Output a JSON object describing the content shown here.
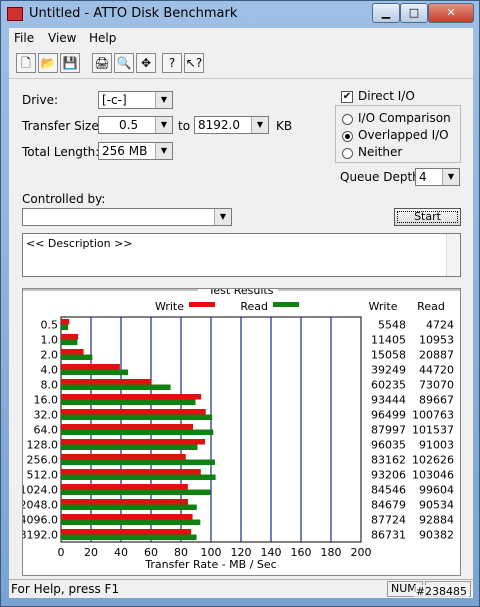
{
  "window": {
    "title": "Untitled - ATTO Disk Benchmark",
    "min_glyph": "▁",
    "max_glyph": "□",
    "close_glyph": "✕"
  },
  "menu": [
    "File",
    "View",
    "Help"
  ],
  "toolbar": [
    {
      "name": "new-icon",
      "glyph": "🗋"
    },
    {
      "name": "open-icon",
      "glyph": "📂"
    },
    {
      "name": "save-icon",
      "glyph": "💾"
    },
    {
      "name": "print-icon",
      "glyph": "🖨"
    },
    {
      "name": "print-preview-icon",
      "glyph": "🔍"
    },
    {
      "name": "move-icon",
      "glyph": "✥"
    },
    {
      "name": "help-icon",
      "glyph": "?"
    },
    {
      "name": "context-help-icon",
      "glyph": "↖?"
    }
  ],
  "form": {
    "drive_label": "Drive:",
    "drive_value": "[-c-]",
    "transfer_size_label": "Transfer Size:",
    "transfer_from": "0.5",
    "to_label": "to",
    "transfer_to": "8192.0",
    "kb_label": "KB",
    "total_length_label": "Total Length:",
    "total_length_value": "256 MB",
    "controlled_by_label": "Controlled by:",
    "controlled_by_value": "",
    "direct_io_label": "Direct I/O",
    "direct_io_checked": true,
    "io_comparison_label": "I/O Comparison",
    "overlapped_io_label": "Overlapped I/O",
    "neither_label": "Neither",
    "selected_mode": "Overlapped I/O",
    "queue_depth_label": "Queue Depth:",
    "queue_depth_value": "4",
    "start_label": "Start",
    "description_value": "<< Description >>"
  },
  "results": {
    "title": "Test Results",
    "write_legend": "Write",
    "read_legend": "Read",
    "write_col": "Write",
    "read_col": "Read"
  },
  "colors": {
    "write": "#e01010",
    "read": "#108010",
    "grid": "#1a2a8a"
  },
  "chart_data": {
    "type": "bar",
    "orientation": "horizontal",
    "categories": [
      "0.5",
      "1.0",
      "2.0",
      "4.0",
      "8.0",
      "16.0",
      "32.0",
      "64.0",
      "128.0",
      "256.0",
      "512.0",
      "1024.0",
      "2048.0",
      "4096.0",
      "8192.0"
    ],
    "series": [
      {
        "name": "Write",
        "values": [
          5548,
          11405,
          15058,
          39249,
          60235,
          93444,
          96499,
          87997,
          96035,
          83162,
          93206,
          84546,
          84679,
          87724,
          86731
        ]
      },
      {
        "name": "Read",
        "values": [
          4724,
          10953,
          20887,
          44720,
          73070,
          89667,
          100763,
          101537,
          91003,
          102626,
          103046,
          99604,
          90534,
          92884,
          90382
        ]
      }
    ],
    "x_ticks": [
      0,
      20,
      40,
      60,
      80,
      100,
      120,
      140,
      160,
      180,
      200
    ],
    "xlim": [
      0,
      200
    ],
    "xlabel": "Transfer Rate - MB / Sec",
    "value_unit_divisor": 1000
  },
  "status": {
    "help_text": "For Help, press F1",
    "num_label": "NUM",
    "watermark": "#238485"
  }
}
